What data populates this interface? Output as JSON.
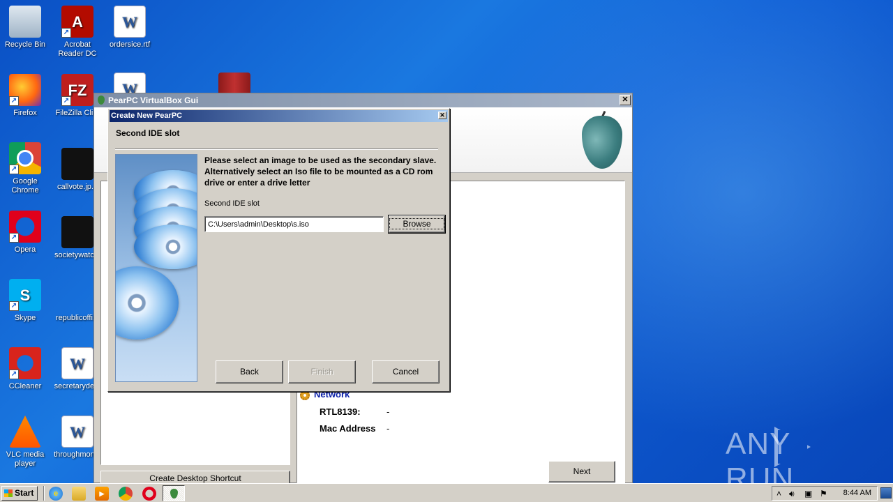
{
  "desktop": {
    "icons": [
      {
        "label": "Recycle Bin",
        "glyph": ""
      },
      {
        "label": "Acrobat Reader DC",
        "glyph": "A"
      },
      {
        "label": "ordersice.rtf",
        "glyph": "W"
      },
      {
        "label": "Firefox",
        "glyph": ""
      },
      {
        "label": "FileZilla Cli...",
        "glyph": "FZ"
      },
      {
        "label": "",
        "glyph": "W"
      },
      {
        "label": "",
        "glyph": ""
      },
      {
        "label": "Google Chrome",
        "glyph": ""
      },
      {
        "label": "callvote.jp...",
        "glyph": ""
      },
      {
        "label": "Opera",
        "glyph": ""
      },
      {
        "label": "societywatc...",
        "glyph": ""
      },
      {
        "label": "Skype",
        "glyph": "S"
      },
      {
        "label": "republicoffi...",
        "glyph": ""
      },
      {
        "label": "CCleaner",
        "glyph": ""
      },
      {
        "label": "secretaryde...",
        "glyph": "W"
      },
      {
        "label": "VLC media player",
        "glyph": ""
      },
      {
        "label": "throughmon...",
        "glyph": "W"
      }
    ]
  },
  "main_window": {
    "title": "PearPC VirtualBox Gui",
    "close_glyph": "✕",
    "network_heading": "Network",
    "specs": [
      {
        "label": "RTL8139:",
        "value": "-"
      },
      {
        "label": "Mac Address",
        "value": "-"
      }
    ],
    "next_label": "Next",
    "shortcut_label": "Create Desktop Shortcut"
  },
  "dialog": {
    "title": "Create New PearPC",
    "close_glyph": "✕",
    "heading": "Second IDE slot",
    "description": "Please select an image to be used as the secondary slave. Alternatively select an Iso file to be mounted as a CD rom drive or enter a drive letter",
    "field_label": "Second IDE slot",
    "path_value": "C:\\Users\\admin\\Desktop\\s.iso",
    "browse_label": "Browse",
    "back_label": "Back",
    "finish_label": "Finish",
    "cancel_label": "Cancel"
  },
  "taskbar": {
    "start_label": "Start",
    "clock": "8:44 AM",
    "tray_up": "˄"
  },
  "watermark": {
    "left": "ANY",
    "right": "RUN"
  }
}
